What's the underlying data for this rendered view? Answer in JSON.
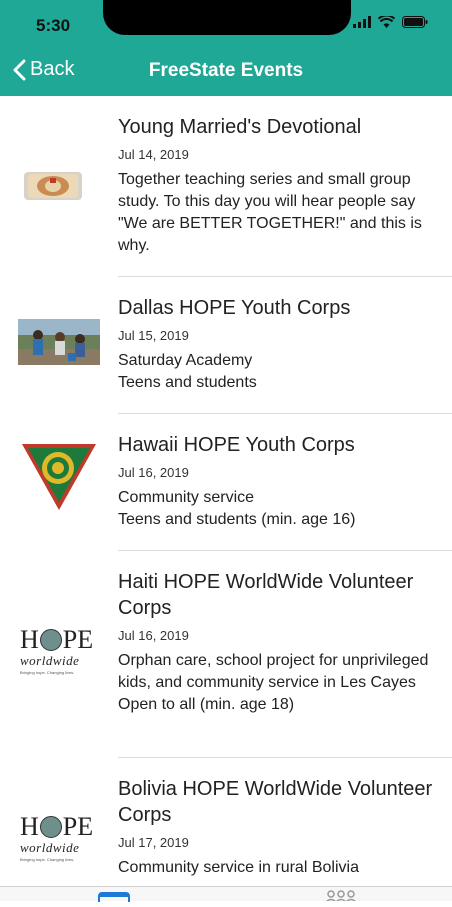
{
  "status_bar": {
    "time": "5:30"
  },
  "nav": {
    "back_label": "Back",
    "title": "FreeState Events"
  },
  "events": [
    {
      "title": "Young Married's Devotional",
      "date": "Jul 14, 2019",
      "description": "Together teaching series and small group study. To this day you will hear people say \"We are BETTER TOGETHER!\" and this is why."
    },
    {
      "title": "Dallas HOPE Youth Corps",
      "date": "Jul 15, 2019",
      "description": "Saturday Academy\nTeens and students"
    },
    {
      "title": "Hawaii HOPE Youth Corps",
      "date": "Jul 16, 2019",
      "description": "Community service\nTeens and students (min. age 16)"
    },
    {
      "title": "Haiti HOPE WorldWide Volunteer Corps",
      "date": "Jul 16, 2019",
      "description": "Orphan care, school project for unprivileged kids, and community service in Les Cayes\nOpen to all (min. age 18)"
    },
    {
      "title": "Bolivia HOPE WorldWide Volunteer Corps",
      "date": "Jul 17, 2019",
      "description": "Community service in rural Bolivia"
    }
  ],
  "logos": {
    "hope_main": "H",
    "hope_tail": "PE",
    "hope_sub": "worldwide",
    "hope_tagline": "Bringing hope. Changing lives."
  },
  "colors": {
    "header": "#1fa896",
    "tab_active": "#1f7ad6"
  }
}
